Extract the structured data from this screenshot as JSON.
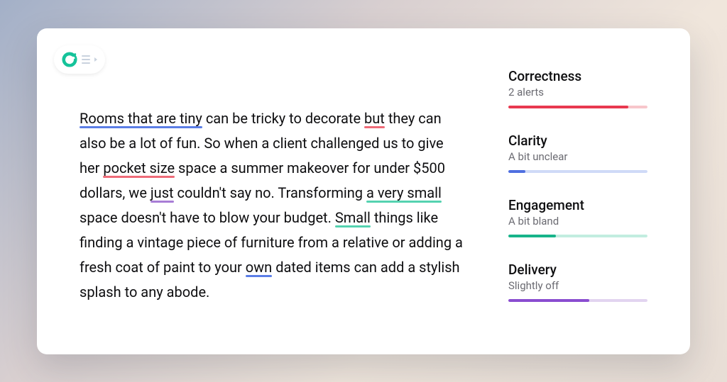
{
  "editor": {
    "segments": [
      {
        "text": "Rooms that are tiny",
        "underline": "blue"
      },
      {
        "text": " can be tricky to decorate "
      },
      {
        "text": "but",
        "underline": "red"
      },
      {
        "text": " they can also be a lot of fun.  So when a client challenged us to give her "
      },
      {
        "text": "pocket size",
        "underline": "red"
      },
      {
        "text": " space a summer makeover for under "
      },
      {
        "text": "$500 dollars",
        "underline": "blue"
      },
      {
        "text": ", we "
      },
      {
        "text": "just",
        "underline": "purple"
      },
      {
        "text": " couldn't say no. Transforming "
      },
      {
        "text": "a very small",
        "underline": "green"
      },
      {
        "text": " space doesn't have to blow your budget. "
      },
      {
        "text": "Small",
        "underline": "green"
      },
      {
        "text": " things like finding a vintage piece of furniture from a relative or adding a fresh coat of paint to your "
      },
      {
        "text": "own",
        "underline": "blue"
      },
      {
        "text": " dated items can add a stylish splash to any abode."
      }
    ]
  },
  "metrics": [
    {
      "title": "Correctness",
      "sub": "2 alerts",
      "color": "red",
      "fill_pct": 86
    },
    {
      "title": "Clarity",
      "sub": "A bit unclear",
      "color": "blue",
      "fill_pct": 12
    },
    {
      "title": "Engagement",
      "sub": "A bit bland",
      "color": "green",
      "fill_pct": 34
    },
    {
      "title": "Delivery",
      "sub": "Slightly off",
      "color": "purple",
      "fill_pct": 58
    }
  ]
}
